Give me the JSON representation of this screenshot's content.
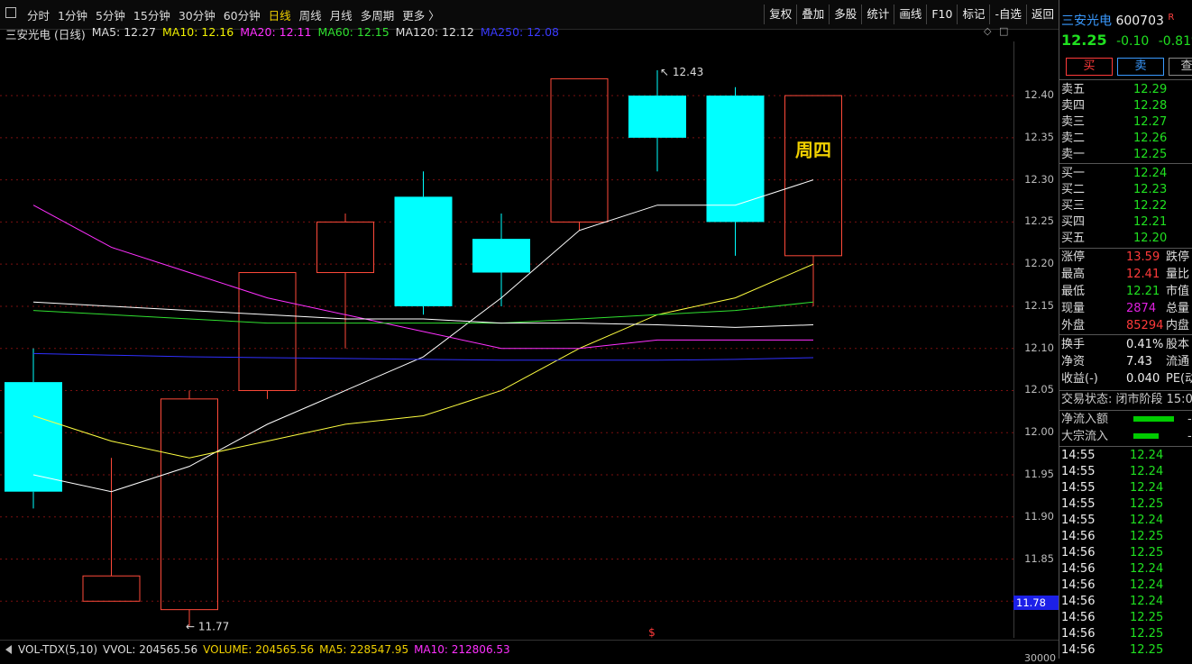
{
  "toolbar": {
    "tabs": [
      "分时",
      "1分钟",
      "5分钟",
      "15分钟",
      "30分钟",
      "60分钟",
      "日线",
      "周线",
      "月线",
      "多周期",
      "更多 〉"
    ],
    "active_tab": "日线",
    "tools": [
      "复权",
      "叠加",
      "多股",
      "统计",
      "画线",
      "F10",
      "标记",
      "-自选",
      "返回"
    ]
  },
  "legend": {
    "title": "三安光电 (日线)",
    "ma5": "MA5: 12.27",
    "ma10": "MA10: 12.16",
    "ma20": "MA20: 12.11",
    "ma60": "MA60: 12.15",
    "ma120": "MA120: 12.12",
    "ma250": "MA250: 12.08"
  },
  "colors": {
    "up": "#ff4a3a",
    "down": "#00ffff",
    "ma5": "#ffffff",
    "ma10": "#ffff40",
    "ma20": "#ff30ff",
    "ma60": "#30e030",
    "ma120": "#ffffff",
    "ma250": "#3030ff"
  },
  "chart_data": {
    "type": "candlestick",
    "ylim": [
      11.78,
      12.46
    ],
    "y_ticks": [
      "12.40",
      "12.35",
      "12.30",
      "12.25",
      "12.20",
      "12.15",
      "12.10",
      "12.05",
      "12.00",
      "11.95",
      "11.90",
      "11.85",
      "11.80"
    ],
    "candles": [
      {
        "open": 12.06,
        "close": 11.93,
        "high": 12.1,
        "low": 11.91,
        "dir": "down"
      },
      {
        "open": 11.8,
        "close": 11.83,
        "high": 11.97,
        "low": 11.8,
        "dir": "up"
      },
      {
        "open": 11.79,
        "close": 12.04,
        "high": 12.05,
        "low": 11.77,
        "dir": "up"
      },
      {
        "open": 12.05,
        "close": 12.19,
        "high": 12.19,
        "low": 12.04,
        "dir": "up"
      },
      {
        "open": 12.19,
        "close": 12.25,
        "high": 12.26,
        "low": 12.1,
        "dir": "up"
      },
      {
        "open": 12.28,
        "close": 12.15,
        "high": 12.31,
        "low": 12.14,
        "dir": "down"
      },
      {
        "open": 12.23,
        "close": 12.19,
        "high": 12.26,
        "low": 12.15,
        "dir": "down"
      },
      {
        "open": 12.25,
        "close": 12.42,
        "high": 12.42,
        "low": 12.24,
        "dir": "up"
      },
      {
        "open": 12.4,
        "close": 12.35,
        "high": 12.43,
        "low": 12.31,
        "dir": "down"
      },
      {
        "open": 12.4,
        "close": 12.25,
        "high": 12.41,
        "low": 12.21,
        "dir": "down"
      },
      {
        "open": 12.21,
        "close": 12.4,
        "high": 12.4,
        "low": 12.15,
        "dir": "up"
      }
    ],
    "series": [
      {
        "key": "ma5",
        "values": [
          11.95,
          11.93,
          11.96,
          12.01,
          12.05,
          12.09,
          12.16,
          12.24,
          12.27,
          12.27,
          12.3
        ]
      },
      {
        "key": "ma10",
        "values": [
          12.02,
          11.99,
          11.97,
          11.99,
          12.01,
          12.02,
          12.05,
          12.1,
          12.14,
          12.16,
          12.2
        ]
      },
      {
        "key": "ma20",
        "values": [
          12.27,
          12.22,
          12.19,
          12.16,
          12.14,
          12.12,
          12.1,
          12.1,
          12.11,
          12.11,
          12.11
        ]
      },
      {
        "key": "ma60",
        "values": [
          12.145,
          12.14,
          12.135,
          12.13,
          12.13,
          12.13,
          12.13,
          12.135,
          12.14,
          12.145,
          12.155
        ]
      },
      {
        "key": "ma120",
        "values": [
          12.155,
          12.15,
          12.145,
          12.14,
          12.135,
          12.135,
          12.13,
          12.13,
          12.128,
          12.125,
          12.128
        ]
      },
      {
        "key": "ma250",
        "values": [
          12.094,
          12.092,
          12.09,
          12.089,
          12.088,
          12.087,
          12.086,
          12.086,
          12.086,
          12.087,
          12.089
        ]
      }
    ],
    "annotations": {
      "high_label": "12.43",
      "low_label": "11.77",
      "weekday": "周四",
      "last_price": "11.78",
      "dollar": "$"
    }
  },
  "vol": {
    "name": "VOL-TDX(5,10)",
    "vvol": "VVOL: 204565.56",
    "volume": "VOLUME: 204565.56",
    "ma5": "MA5: 228547.95",
    "ma10": "MA10: 212806.53",
    "tick": "30000"
  },
  "panel": {
    "name": "三安光电",
    "code": "600703",
    "flag": "R",
    "price": "12.25",
    "change": "-0.10",
    "pct": "-0.81%",
    "buy": "买",
    "sell": "卖",
    "third": "查",
    "asks": [
      {
        "label": "卖五",
        "price": "12.29"
      },
      {
        "label": "卖四",
        "price": "12.28"
      },
      {
        "label": "卖三",
        "price": "12.27"
      },
      {
        "label": "卖二",
        "price": "12.26"
      },
      {
        "label": "卖一",
        "price": "12.25"
      }
    ],
    "bids": [
      {
        "label": "买一",
        "price": "12.24"
      },
      {
        "label": "买二",
        "price": "12.23"
      },
      {
        "label": "买三",
        "price": "12.22"
      },
      {
        "label": "买四",
        "price": "12.21"
      },
      {
        "label": "买五",
        "price": "12.20"
      }
    ],
    "stats": [
      {
        "label": "涨停",
        "value": "13.59",
        "label2": "跌停"
      },
      {
        "label": "最高",
        "value": "12.41",
        "label2": "量比"
      },
      {
        "label": "最低",
        "value": "12.21",
        "label2": "市值"
      },
      {
        "label": "现量",
        "value": "2874",
        "label2": "总量"
      },
      {
        "label": "外盘",
        "value": "85294",
        "label2": "内盘"
      }
    ],
    "fin": [
      {
        "label": "换手",
        "value": "0.41%",
        "label2": "股本"
      },
      {
        "label": "净资",
        "value": "7.43",
        "label2": "流通"
      },
      {
        "label": "收益(-)",
        "value": "0.040",
        "label2": "PE(动"
      }
    ],
    "trade_status": "交易状态: 闭市阶段 15:0",
    "net_inflow": "净流入额",
    "block_inflow": "大宗流入",
    "dash": "-",
    "ticks": [
      {
        "t": "14:55",
        "p": "12.24"
      },
      {
        "t": "14:55",
        "p": "12.24"
      },
      {
        "t": "14:55",
        "p": "12.24"
      },
      {
        "t": "14:55",
        "p": "12.25"
      },
      {
        "t": "14:55",
        "p": "12.24"
      },
      {
        "t": "14:56",
        "p": "12.25"
      },
      {
        "t": "14:56",
        "p": "12.25"
      },
      {
        "t": "14:56",
        "p": "12.24"
      },
      {
        "t": "14:56",
        "p": "12.24"
      },
      {
        "t": "14:56",
        "p": "12.24"
      },
      {
        "t": "14:56",
        "p": "12.25"
      },
      {
        "t": "14:56",
        "p": "12.25"
      },
      {
        "t": "14:56",
        "p": "12.25"
      }
    ]
  }
}
